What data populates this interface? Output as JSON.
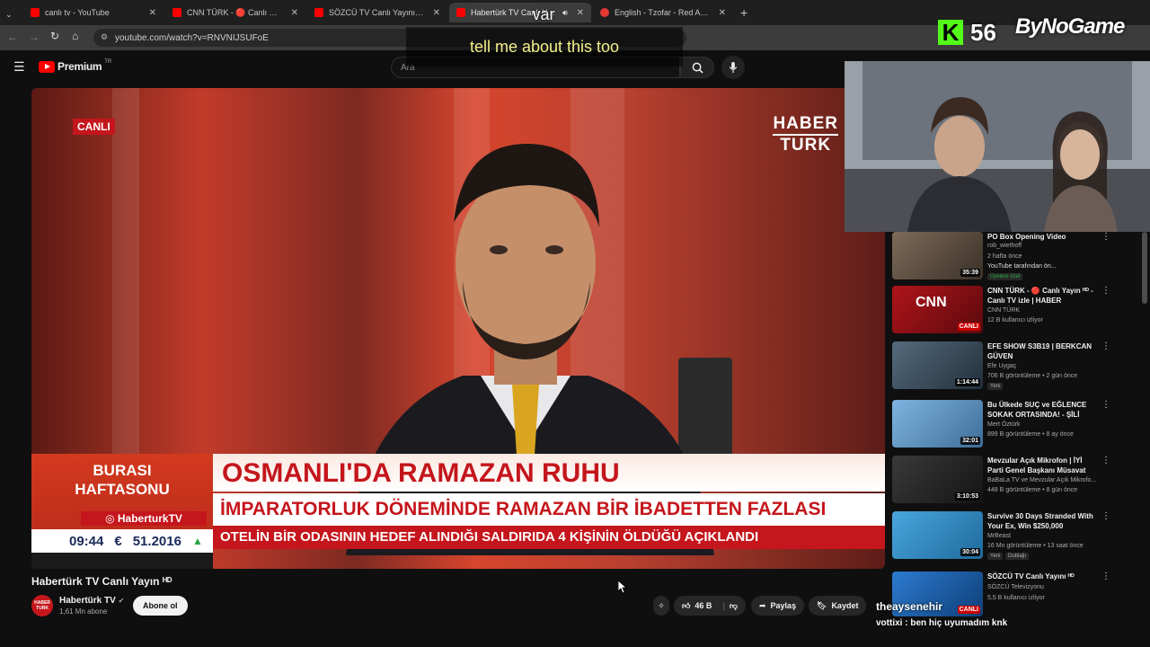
{
  "browser": {
    "tabs": [
      {
        "title": "canlı tv - YouTube",
        "favicon_color": "#ff0000"
      },
      {
        "title": "CNN TÜRK - 🔴 Canlı Yayın ᴴᴰ",
        "favicon_color": "#ff0000"
      },
      {
        "title": "SÖZCÜ TV Canlı Yayını ᴴᴰ - You",
        "favicon_color": "#ff0000"
      },
      {
        "title": "Habertürk TV Canlı Yayın",
        "favicon_color": "#ff0000"
      },
      {
        "title": "English - Tzofar - Red Alert",
        "favicon_color": "#e53935"
      }
    ],
    "url": "youtube.com/watch?v=RNVNIJSUFoE"
  },
  "youtube": {
    "logo_text": "Premium",
    "logo_sup": "TR",
    "search_placeholder": "Ara"
  },
  "video": {
    "canli_badge": "CANLI",
    "logo_line1": "HABER",
    "logo_line2": "TURK",
    "lt_burasi": "BURASI",
    "lt_haftasonu": "HAFTASONU",
    "lt_instagram": "HaberturkTV",
    "lt_time": "09:44",
    "lt_currency": "€",
    "lt_rate": "51.2016",
    "lt_title": "OSMANLI'DA RAMAZAN RUHU",
    "lt_subtitle": "İMPARATORLUK DÖNEMİNDE RAMAZAN BİR İBADETTEN FAZLASI MIYDI?",
    "lt_ticker": "OTELİN BİR ODASININ HEDEF ALINDIĞI SALDIRIDA 4 KİŞİNİN ÖLDÜĞÜ AÇIKLANDI"
  },
  "meta": {
    "title": "Habertürk TV Canlı Yayın ᴴᴰ",
    "avatar_text": "HABER TURK",
    "channel": "Habertürk TV",
    "subscribers": "1,61 Mn abone",
    "subscribe_label": "Abone ol",
    "like_count": "46 B",
    "share_label": "Paylaş",
    "save_label": "Kaydet"
  },
  "recommendations": [
    {
      "title": "PO Box Opening Video",
      "channel": "rob_wiethoff",
      "meta": "2 hafta önce",
      "meta2": "YouTube tarafından ön...",
      "badge": "Üyelere özel",
      "duration": "35:39",
      "thumb_color": "#6b5a4a"
    },
    {
      "title": "CNN TÜRK - 🔴 Canlı Yayın ᴴᴰ - Canlı TV izle | HABER",
      "channel": "CNN TÜRK",
      "meta": "12 B kullanıcı izliyor",
      "duration": "CANLI",
      "thumb_color": "#9b0f14"
    },
    {
      "title": "EFE SHOW S3B19 | BERKCAN GÜVEN",
      "channel": "Efe Uygaç",
      "meta": "706 B görüntüleme • 2 gün önce",
      "badge": "Yeni",
      "duration": "1:14:44",
      "thumb_color": "#3d4b5e"
    },
    {
      "title": "Bu Ülkede SUÇ ve EĞLENCE SOKAK ORTASINDA! - ŞİLİ",
      "channel": "Mert Öztürk",
      "meta": "899 B görüntüleme • 8 ay önce",
      "duration": "32:01",
      "thumb_color": "#4b7fb0"
    },
    {
      "title": "Mevzular Açık Mikrofon | İYİ Parti Genel Başkanı Müsavat ...",
      "channel": "BaBaLa TV ve Mevzular Açık Mikrofo...",
      "meta": "448 B görüntüleme • 8 gün önce",
      "duration": "3:10:53",
      "thumb_color": "#2b2b2b"
    },
    {
      "title": "Survive 30 Days Stranded With Your Ex, Win $250,000",
      "channel": "MrBeast",
      "meta": "16 Mn görüntüleme • 13 saat önce",
      "badge": "Yeni",
      "badge2": "Dublajlı",
      "duration": "30:04",
      "thumb_color": "#2e8fc9"
    },
    {
      "title": "SÖZCÜ TV Canlı Yayını ᴴᴰ",
      "channel": "SÖZCÜ Televizyonu",
      "meta": "5,5 B kullanıcı izliyor",
      "duration": "CANLI",
      "thumb_color": "#1d5fa8"
    }
  ],
  "overlay": {
    "caption_top": "var",
    "caption_main": "tell me about this too",
    "k_count": "56",
    "brand": "ByNoGame",
    "chat_user_top": "theaysenehir",
    "chat_user": "vottixi",
    "chat_message": "ben hiç uyumadım knk"
  }
}
